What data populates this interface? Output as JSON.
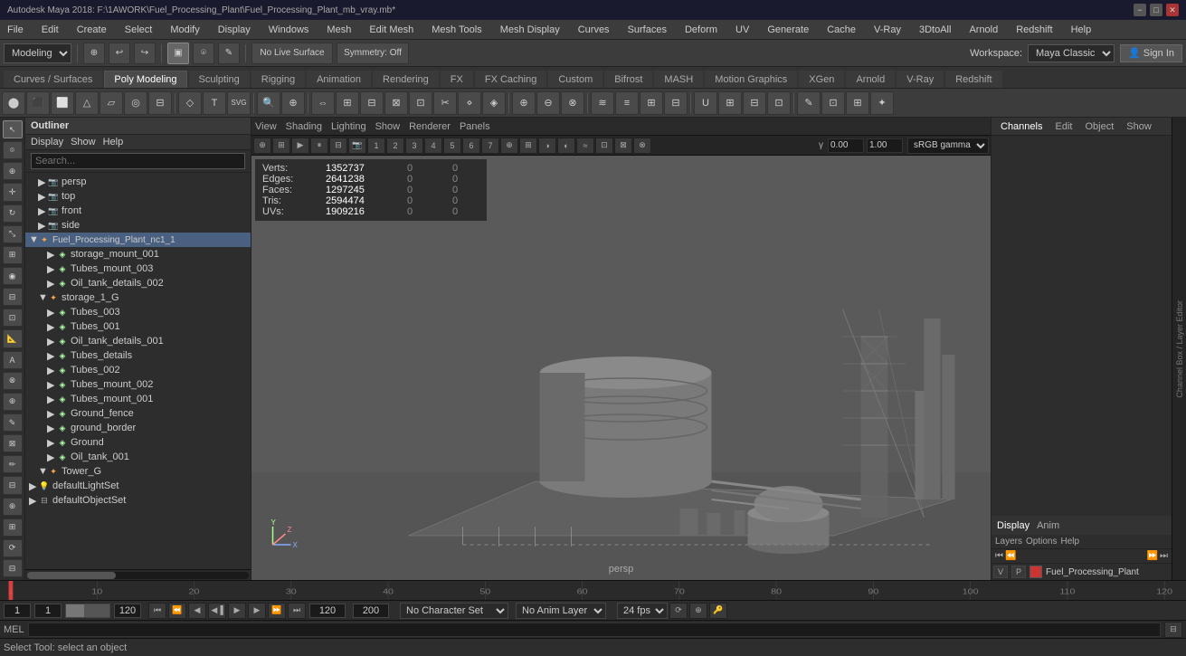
{
  "titleBar": {
    "title": "Autodesk Maya 2018: F:\\1AWORK\\Fuel_Processing_Plant\\Fuel_Processing_Plant_mb_vray.mb*",
    "winControls": [
      "−",
      "□",
      "✕"
    ]
  },
  "menuBar": {
    "items": [
      "File",
      "Edit",
      "Create",
      "Select",
      "Modify",
      "Display",
      "Windows",
      "Mesh",
      "Edit Mesh",
      "Mesh Tools",
      "Mesh Display",
      "Curves",
      "Surfaces",
      "Deform",
      "UV",
      "Generate",
      "Cache",
      "V-Ray",
      "3DtoAll",
      "Arnold",
      "Redshift",
      "Help"
    ]
  },
  "toolbar1": {
    "modeling": "Modeling",
    "workspace_label": "Workspace:",
    "workspace": "Maya Classic",
    "sign_in": "Sign In"
  },
  "moduleTabs": {
    "items": [
      "Curves / Surfaces",
      "Poly Modeling",
      "Sculpting",
      "Rigging",
      "Animation",
      "Rendering",
      "FX",
      "FX Caching",
      "Custom",
      "Bifrost",
      "MASH",
      "Motion Graphics",
      "XGen",
      "Arnold",
      "V-Ray",
      "Redshift"
    ],
    "active": "Poly Modeling"
  },
  "outliner": {
    "title": "Outliner",
    "menu": [
      "Display",
      "Show",
      "Help"
    ],
    "search_placeholder": "Search...",
    "tree": [
      {
        "id": "persp",
        "label": "persp",
        "indent": 1,
        "type": "camera",
        "arrow": "▶"
      },
      {
        "id": "top",
        "label": "top",
        "indent": 1,
        "type": "camera",
        "arrow": "▶"
      },
      {
        "id": "front",
        "label": "front",
        "indent": 1,
        "type": "camera",
        "arrow": "▶"
      },
      {
        "id": "side",
        "label": "side",
        "indent": 1,
        "type": "camera",
        "arrow": "▶"
      },
      {
        "id": "fuel_plant",
        "label": "Fuel_Processing_Plant_nc1_1",
        "indent": 0,
        "type": "group",
        "arrow": "▼"
      },
      {
        "id": "storage_mount_001",
        "label": "storage_mount_001",
        "indent": 2,
        "type": "mesh",
        "arrow": "▶"
      },
      {
        "id": "tubes_mount_003",
        "label": "Tubes_mount_003",
        "indent": 2,
        "type": "mesh",
        "arrow": "▶"
      },
      {
        "id": "oil_tank_details_002",
        "label": "Oil_tank_details_002",
        "indent": 2,
        "type": "mesh",
        "arrow": "▶"
      },
      {
        "id": "storage_1_g",
        "label": "storage_1_G",
        "indent": 1,
        "type": "group",
        "arrow": "▼"
      },
      {
        "id": "tubes_003",
        "label": "Tubes_003",
        "indent": 2,
        "type": "mesh",
        "arrow": "▶"
      },
      {
        "id": "tubes_001",
        "label": "Tubes_001",
        "indent": 2,
        "type": "mesh",
        "arrow": "▶"
      },
      {
        "id": "oil_tank_details_001",
        "label": "Oil_tank_details_001",
        "indent": 2,
        "type": "mesh",
        "arrow": "▶"
      },
      {
        "id": "tubes_details",
        "label": "Tubes_details",
        "indent": 2,
        "type": "mesh",
        "arrow": "▶"
      },
      {
        "id": "tubes_002",
        "label": "Tubes_002",
        "indent": 2,
        "type": "mesh",
        "arrow": "▶"
      },
      {
        "id": "tubes_mount_002",
        "label": "Tubes_mount_002",
        "indent": 2,
        "type": "mesh",
        "arrow": "▶"
      },
      {
        "id": "tubes_mount_001",
        "label": "Tubes_mount_001",
        "indent": 2,
        "type": "mesh",
        "arrow": "▶"
      },
      {
        "id": "ground_fence",
        "label": "Ground_fence",
        "indent": 2,
        "type": "mesh",
        "arrow": "▶"
      },
      {
        "id": "ground_border",
        "label": "ground_border",
        "indent": 2,
        "type": "mesh",
        "arrow": "▶"
      },
      {
        "id": "ground",
        "label": "Ground",
        "indent": 2,
        "type": "mesh",
        "arrow": "▶"
      },
      {
        "id": "oil_tank_001",
        "label": "Oil_tank_001",
        "indent": 2,
        "type": "mesh",
        "arrow": "▶"
      },
      {
        "id": "tower_g",
        "label": "Tower_G",
        "indent": 1,
        "type": "group",
        "arrow": "▼"
      },
      {
        "id": "defaultLightSet",
        "label": "defaultLightSet",
        "indent": 0,
        "type": "light",
        "arrow": "▶"
      },
      {
        "id": "defaultObjectSet",
        "label": "defaultObjectSet",
        "indent": 0,
        "type": "set",
        "arrow": "▶"
      }
    ]
  },
  "viewport": {
    "menuItems": [
      "View",
      "Shading",
      "Lighting",
      "Show",
      "Renderer",
      "Panels"
    ],
    "stats": {
      "verts_label": "Verts:",
      "verts_val": "1352737",
      "verts_z1": "0",
      "verts_z2": "0",
      "edges_label": "Edges:",
      "edges_val": "2641238",
      "edges_z1": "0",
      "edges_z2": "0",
      "faces_label": "Faces:",
      "faces_val": "1297245",
      "faces_z1": "0",
      "faces_z2": "0",
      "tris_label": "Tris:",
      "tris_val": "2594474",
      "tris_z1": "0",
      "tris_z2": "0",
      "uvs_label": "UVs:",
      "uvs_val": "1909216",
      "uvs_z1": "0",
      "uvs_z2": "0"
    },
    "persp_label": "persp",
    "gamma_val": "0.00",
    "exposure_val": "1.00",
    "colorspace": "sRGB gamma"
  },
  "channelsBox": {
    "tabs": [
      "Display",
      "Anim"
    ],
    "active": "Display",
    "sub_tabs": [
      "Layers",
      "Options",
      "Help"
    ],
    "layer_btns": [
      "◀◀",
      "◀",
      "▶",
      "▶▶"
    ],
    "layer_name": "Fuel_Processing_Plant",
    "layer_v": "V",
    "layer_p": "P"
  },
  "rightStrip": {
    "labels": [
      "Channel Box / Layer Editor"
    ]
  },
  "timeline": {
    "start": "1",
    "end": "120",
    "current": "1",
    "ticks": [
      "1",
      "10",
      "20",
      "30",
      "40",
      "50",
      "60",
      "70",
      "80",
      "90",
      "100",
      "110",
      "120"
    ],
    "range_start": "1",
    "range_end": "120",
    "anim_end": "200",
    "fps": "24 fps",
    "no_char_set": "No Character Set",
    "no_anim_layer": "No Anim Layer"
  },
  "mel": {
    "label": "MEL",
    "input": "",
    "status_text": "Select Tool: select an object"
  },
  "colors": {
    "active_tab_bg": "#4a4a4a",
    "viewport_bg": "#5a5a5a",
    "layer_color": "#cc3333"
  }
}
